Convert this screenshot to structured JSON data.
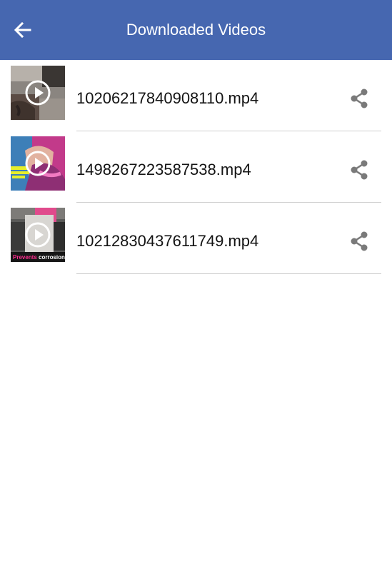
{
  "toolbar": {
    "title": "Downloaded Videos",
    "back_icon": "arrow-back-icon",
    "background": "#4667b0"
  },
  "videos": [
    {
      "filename": "10206217840908110.mp4",
      "thumb_text": ""
    },
    {
      "filename": "1498267223587538.mp4",
      "thumb_text": ""
    },
    {
      "filename": "10212830437611749.mp4",
      "thumb_text": "Prevents corrosion"
    }
  ],
  "icons": {
    "play": "play-circle-icon",
    "share": "share-icon"
  }
}
